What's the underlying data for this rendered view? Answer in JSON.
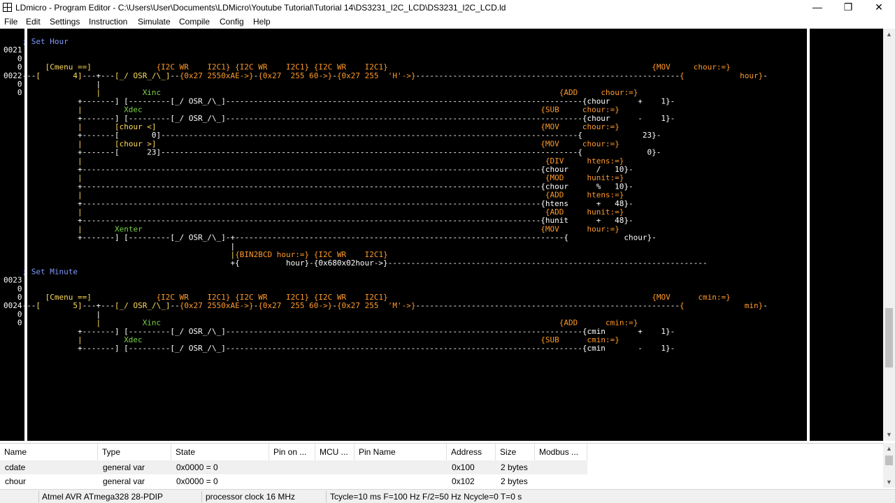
{
  "window": {
    "title": "LDmicro - Program Editor - C:\\Users\\User\\Documents\\LDMicro\\Youtube Tutorial\\Tutorial 14\\DS3231_I2C_LCD\\DS3231_I2C_LCD.ld",
    "minimize": "—",
    "restore": "❐",
    "close": "✕"
  },
  "menu": {
    "file": "File",
    "edit": "Edit",
    "settings": "Settings",
    "instruction": "Instruction",
    "simulate": "Simulate",
    "compile": "Compile",
    "config": "Config",
    "help": "Help"
  },
  "colors": {
    "background": "#000000",
    "wire": "#ffffff",
    "element": "#ffdc5a",
    "name": "#7ad24a",
    "number": "#ffa050",
    "comment": "#7f9bff",
    "function": "#ff9a2a",
    "rung_num": "#ffffff"
  },
  "ladder": [
    [
      {
        "t": "    ; Set Hour",
        "c": "comment"
      }
    ],
    [
      {
        "t": "0021",
        "c": "rung_num"
      }
    ],
    [
      {
        "t": "   0",
        "c": "rung_num"
      }
    ],
    [
      {
        "t": "   0",
        "c": "rung_num"
      },
      {
        "t": "     [Cmenu ==]              "
      },
      {
        "t": "{I2C WR    I2C1} {I2C WR    I2C1} {I2C WR    I2C1}",
        "c": "function"
      },
      {
        "t": "                                                         "
      },
      {
        "t": "{MOV     chour:=}",
        "c": "function"
      }
    ],
    [
      {
        "t": "0022",
        "c": "rung_num"
      },
      {
        "t": "---",
        "c": "wire"
      },
      {
        "t": "[       4]",
        "c": "element"
      },
      {
        "t": "---+---",
        "c": "wire"
      },
      {
        "t": "[_/ OSR_/\\_]",
        "c": "element"
      },
      {
        "t": "--",
        "c": "wire"
      },
      {
        "t": "{0x27 2550xAE->}",
        "c": "function"
      },
      {
        "t": "-",
        "c": "wire"
      },
      {
        "t": "{0x27  255 60->}",
        "c": "function"
      },
      {
        "t": "-",
        "c": "wire"
      },
      {
        "t": "{0x27 255  'H'->}",
        "c": "function"
      },
      {
        "t": "---------------------------------------------------------",
        "c": "wire"
      },
      {
        "t": "{            hour}",
        "c": "function"
      },
      {
        "t": "-",
        "c": "wire"
      }
    ],
    [
      {
        "t": "   0",
        "c": "rung_num"
      },
      {
        "t": "                |",
        "c": "wire"
      }
    ],
    [
      {
        "t": "   0",
        "c": "rung_num"
      },
      {
        "t": "                |         "
      },
      {
        "t": "Xinc",
        "c": "name"
      },
      {
        "t": "                                                                                      "
      },
      {
        "t": "{ADD     chour:=}",
        "c": "function"
      }
    ],
    [
      {
        "t": "                +-------] [---------[_/ OSR_/\\_]-----------------------------------------------------------------------------{chour      +    1}-",
        "c": "wire"
      }
    ],
    [
      {
        "t": "                |         "
      },
      {
        "t": "Xdec",
        "c": "name"
      },
      {
        "t": "                                                                                      "
      },
      {
        "t": "{SUB     chour:=}",
        "c": "function"
      }
    ],
    [
      {
        "t": "                +-------] [---------[_/ OSR_/\\_]-----------------------------------------------------------------------------{chour      -    1}-",
        "c": "wire"
      }
    ],
    [
      {
        "t": "                |       "
      },
      {
        "t": "[chour <]",
        "c": "element"
      },
      {
        "t": "                                                                                   "
      },
      {
        "t": "{MOV     chour:=}",
        "c": "function"
      }
    ],
    [
      {
        "t": "                +-------[       0]------------------------------------------------------------------------------------------{             23}-",
        "c": "wire"
      }
    ],
    [
      {
        "t": "                |       "
      },
      {
        "t": "[chour >]",
        "c": "element"
      },
      {
        "t": "                                                                                   "
      },
      {
        "t": "{MOV     chour:=}",
        "c": "function"
      }
    ],
    [
      {
        "t": "                +-------[      23]------------------------------------------------------------------------------------------{              0}-",
        "c": "wire"
      }
    ],
    [
      {
        "t": "                |                                                                                                    "
      },
      {
        "t": "{DIV     htens:=}",
        "c": "function"
      }
    ],
    [
      {
        "t": "                +---------------------------------------------------------------------------------------------------{chour      /   10}-",
        "c": "wire"
      }
    ],
    [
      {
        "t": "                |                                                                                                    "
      },
      {
        "t": "{MOD     hunit:=}",
        "c": "function"
      }
    ],
    [
      {
        "t": "                +---------------------------------------------------------------------------------------------------{chour      %   10}-",
        "c": "wire"
      }
    ],
    [
      {
        "t": "                |                                                                                                    "
      },
      {
        "t": "{ADD     htens:=}",
        "c": "function"
      }
    ],
    [
      {
        "t": "                +---------------------------------------------------------------------------------------------------{htens      +   48}-",
        "c": "wire"
      }
    ],
    [
      {
        "t": "                |                                                                                                    "
      },
      {
        "t": "{ADD     hunit:=}",
        "c": "function"
      }
    ],
    [
      {
        "t": "                +---------------------------------------------------------------------------------------------------{hunit      +   48}-",
        "c": "wire"
      }
    ],
    [
      {
        "t": "                |       "
      },
      {
        "t": "Xenter",
        "c": "name"
      },
      {
        "t": "                                                                                      "
      },
      {
        "t": "{MOV      hour:=}",
        "c": "function"
      }
    ],
    [
      {
        "t": "                +-------] [---------[_/ OSR_/\\_]-+-----------------------------------------------------------------------{            chour}-",
        "c": "wire"
      }
    ],
    [
      {
        "t": "                                                 |",
        "c": "wire"
      }
    ],
    [
      {
        "t": "                                                 |"
      },
      {
        "t": "{BIN2BCD hour:=} {I2C WR    I2C1}",
        "c": "function"
      }
    ],
    [
      {
        "t": "                                                 +{          hour}-{0x680x02hour->}---------------------------------------------------------------------",
        "c": "wire"
      }
    ],
    [
      {
        "t": "    ; Set Minute",
        "c": "comment"
      }
    ],
    [
      {
        "t": "0023",
        "c": "rung_num"
      }
    ],
    [
      {
        "t": "   0",
        "c": "rung_num"
      }
    ],
    [
      {
        "t": "   0",
        "c": "rung_num"
      },
      {
        "t": "     [Cmenu ==]              "
      },
      {
        "t": "{I2C WR    I2C1} {I2C WR    I2C1} {I2C WR    I2C1}",
        "c": "function"
      },
      {
        "t": "                                                         "
      },
      {
        "t": "{MOV      cmin:=}",
        "c": "function"
      }
    ],
    [
      {
        "t": "0024",
        "c": "rung_num"
      },
      {
        "t": "---",
        "c": "wire"
      },
      {
        "t": "[       5]",
        "c": "element"
      },
      {
        "t": "---+---",
        "c": "wire"
      },
      {
        "t": "[_/ OSR_/\\_]",
        "c": "element"
      },
      {
        "t": "--",
        "c": "wire"
      },
      {
        "t": "{0x27 2550xAE->}",
        "c": "function"
      },
      {
        "t": "-",
        "c": "wire"
      },
      {
        "t": "{0x27  255 60->}",
        "c": "function"
      },
      {
        "t": "-",
        "c": "wire"
      },
      {
        "t": "{0x27 255  'M'->}",
        "c": "function"
      },
      {
        "t": "---------------------------------------------------------",
        "c": "wire"
      },
      {
        "t": "{             min}",
        "c": "function"
      },
      {
        "t": "-",
        "c": "wire"
      }
    ],
    [
      {
        "t": "   0",
        "c": "rung_num"
      },
      {
        "t": "                |",
        "c": "wire"
      }
    ],
    [
      {
        "t": "   0",
        "c": "rung_num"
      },
      {
        "t": "                |         "
      },
      {
        "t": "Xinc",
        "c": "name"
      },
      {
        "t": "                                                                                      "
      },
      {
        "t": "{ADD      cmin:=}",
        "c": "function"
      }
    ],
    [
      {
        "t": "                +-------] [---------[_/ OSR_/\\_]-----------------------------------------------------------------------------{cmin       +    1}-",
        "c": "wire"
      }
    ],
    [
      {
        "t": "                |         "
      },
      {
        "t": "Xdec",
        "c": "name"
      },
      {
        "t": "                                                                                      "
      },
      {
        "t": "{SUB      cmin:=}",
        "c": "function"
      }
    ],
    [
      {
        "t": "                +-------] [---------[_/ OSR_/\\_]-----------------------------------------------------------------------------{cmin       -    1}-",
        "c": "wire"
      }
    ]
  ],
  "io_list": {
    "columns": [
      "Name",
      "Type",
      "State",
      "Pin on ...",
      "MCU ...",
      "Pin Name",
      "Address",
      "Size",
      "Modbus ..."
    ],
    "rows": [
      [
        "cdate",
        "general var",
        "0x0000 = 0",
        "",
        "",
        "",
        "0x100",
        "2 bytes",
        ""
      ],
      [
        "chour",
        "general var",
        "0x0000 = 0",
        "",
        "",
        "",
        "0x102",
        "2 bytes",
        ""
      ]
    ]
  },
  "status": {
    "mcu": "Atmel AVR ATmega328 28-PDIP",
    "clock": "processor clock 16 MHz",
    "timing": "Tcycle=10 ms F=100 Hz F/2=50 Hz Ncycle=0 T=0 s"
  }
}
